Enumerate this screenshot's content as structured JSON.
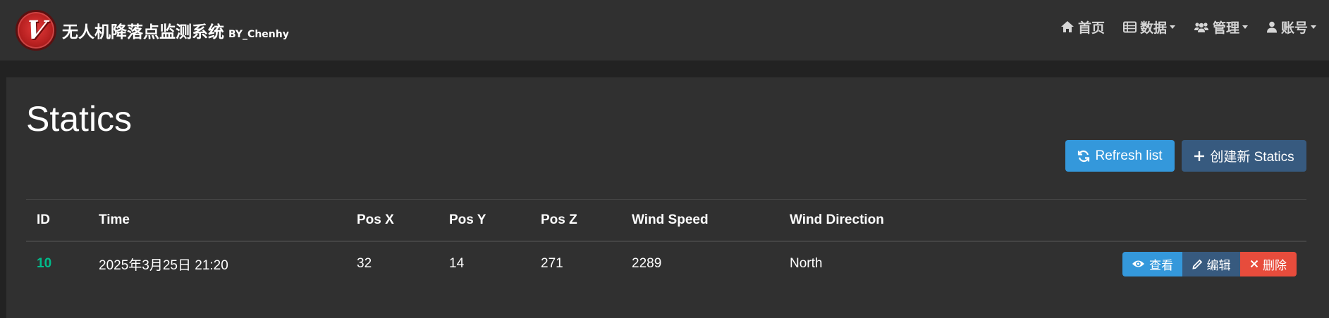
{
  "brand": {
    "title": "无人机降落点监测系统",
    "subtitle": "BY_Chenhy",
    "logo_icon": "drone-v-logo"
  },
  "nav": {
    "home": "首页",
    "data": "数据",
    "manage": "管理",
    "account": "账号"
  },
  "page": {
    "title": "Statics",
    "refresh_label": "Refresh list",
    "create_label": "创建新 Statics"
  },
  "table": {
    "columns": [
      "ID",
      "Time",
      "Pos X",
      "Pos Y",
      "Pos Z",
      "Wind Speed",
      "Wind Direction"
    ],
    "rows": [
      {
        "id": "10",
        "time": "2025年3月25日 21:20",
        "pos_x": "32",
        "pos_y": "14",
        "pos_z": "271",
        "wind_speed": "2289",
        "wind_direction": "North"
      }
    ],
    "actions": {
      "view": "查看",
      "edit": "编辑",
      "delete": "删除"
    }
  },
  "colors": {
    "navbar_bg": "#303030",
    "page_bg": "#222222",
    "card_bg": "#303030",
    "info": "#3498db",
    "primary": "#375a7f",
    "danger": "#e74c3c",
    "success": "#00bc8c"
  }
}
